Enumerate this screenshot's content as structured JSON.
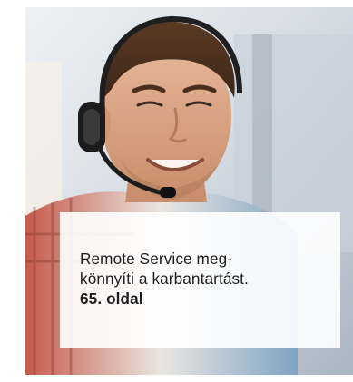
{
  "teaser": {
    "caption_line1": "Remote Service meg-",
    "caption_line2": "könnyíti a karbantartást.",
    "page_reference": "65. oldal",
    "photo_subject_icon": "person-with-headset",
    "colors": {
      "caption_background": "#ffffff",
      "caption_text": "#1d1d1d",
      "photo_background": "#dfe4ea"
    }
  }
}
